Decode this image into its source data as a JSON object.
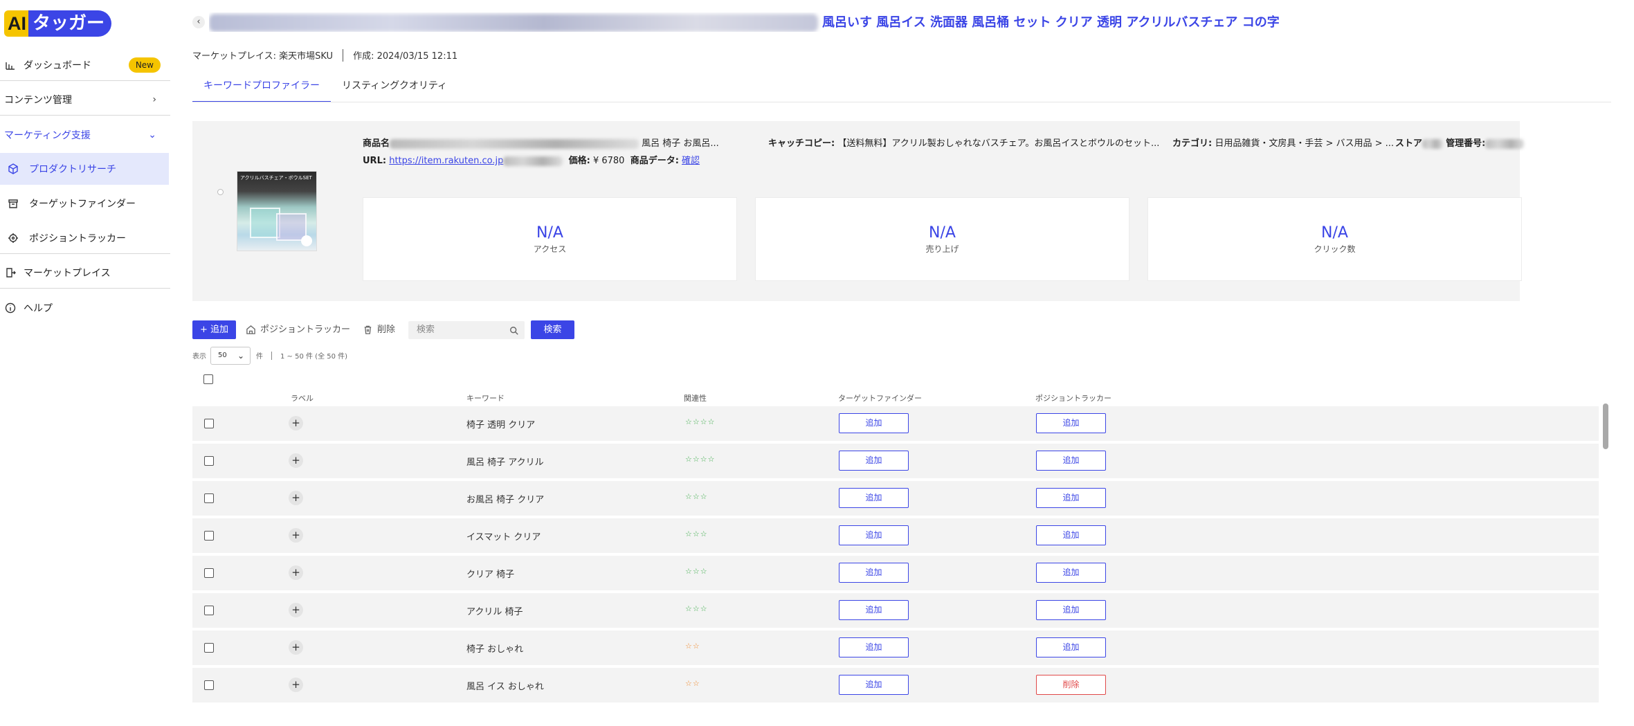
{
  "brand": {
    "ai": "AI",
    "name": "タッガー"
  },
  "sidebar": {
    "items": [
      {
        "label": "ダッシュボード",
        "badge": "New"
      },
      {
        "label": "コンテンツ管理",
        "chevron": "›"
      },
      {
        "label": "マーケティング支援",
        "chevron": "⌄"
      },
      {
        "label": "プロダクトリサーチ"
      },
      {
        "label": "ターゲットファインダー"
      },
      {
        "label": "ポジショントラッカー"
      },
      {
        "label": "マーケットプレイス"
      },
      {
        "label": "ヘルプ"
      }
    ]
  },
  "header": {
    "back": "‹",
    "title_visible": "風呂いす 風呂イス 洗面器 風呂桶 セット クリア 透明 アクリルバスチェア コの字",
    "marketplace": "マーケットプレイス: 楽天市場SKU",
    "created": "作成: 2024/03/15 12:11"
  },
  "tabs": [
    "キーワードプロファイラー",
    "リスティングクオリティ"
  ],
  "product": {
    "image_caption": "アクリルバスチェア・ボウルSET",
    "name_label": "商品名",
    "name_tail": "風呂 椅子 お風呂...",
    "catch_label": "キャッチコピー:",
    "catch_value": "【送料無料】アクリル製おしゃれなバスチェア。お風呂イスとボウルのセット...",
    "category_label": "カテゴリ:",
    "category_value": "日用品雑貨・文房具・手芸 > バス用品 > ...",
    "store_label": "ストア",
    "mgmt_label": "管理番号:",
    "url_label": "URL:",
    "url_value": "https://item.rakuten.co.jp",
    "price_label": "価格:",
    "price_value": "¥ 6780",
    "data_label": "商品データ:",
    "data_link": "確認"
  },
  "stats": [
    {
      "value": "N/A",
      "label": "アクセス"
    },
    {
      "value": "N/A",
      "label": "売り上げ"
    },
    {
      "value": "N/A",
      "label": "クリック数"
    }
  ],
  "toolbar": {
    "add": "+ 追加",
    "tracker": "ポジショントラッカー",
    "delete": "削除",
    "search_placeholder": "検索",
    "search_button": "検索"
  },
  "pager": {
    "show_label": "表示",
    "per_page": "50",
    "unit": "件",
    "range": "1 ~ 50 件 (全 50 件)"
  },
  "table": {
    "columns": [
      "ラベル",
      "キーワード",
      "関連性",
      "ターゲットファインダー",
      "ポジショントラッカー"
    ],
    "rows": [
      {
        "keyword": "椅子 透明 クリア",
        "relevance": 4,
        "tf": "追加",
        "pt": "追加"
      },
      {
        "keyword": "風呂 椅子 アクリル",
        "relevance": 4,
        "tf": "追加",
        "pt": "追加"
      },
      {
        "keyword": "お風呂 椅子 クリア",
        "relevance": 3,
        "tf": "追加",
        "pt": "追加"
      },
      {
        "keyword": "イスマット クリア",
        "relevance": 3,
        "tf": "追加",
        "pt": "追加"
      },
      {
        "keyword": "クリア 椅子",
        "relevance": 3,
        "tf": "追加",
        "pt": "追加"
      },
      {
        "keyword": "アクリル 椅子",
        "relevance": 3,
        "tf": "追加",
        "pt": "追加"
      },
      {
        "keyword": "椅子 おしゃれ",
        "relevance": 2,
        "tf": "追加",
        "pt": "追加"
      },
      {
        "keyword": "風呂 イス おしゃれ",
        "relevance": 2,
        "tf": "追加",
        "pt": "削除"
      }
    ]
  },
  "colors": {
    "accent": "#3b45e6",
    "brand_yellow": "#f5c400",
    "danger": "#e04848",
    "star_high": "#3fae4c",
    "star_low": "#f08a2e"
  }
}
